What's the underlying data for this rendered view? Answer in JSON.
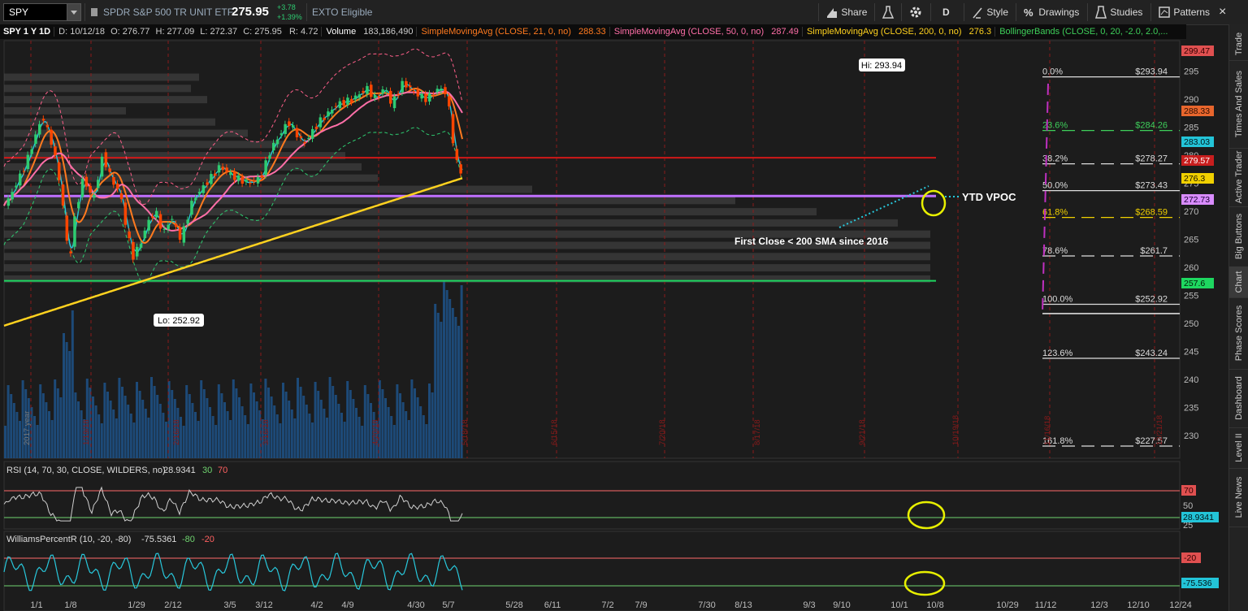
{
  "toolbar": {
    "symbol": "SPY",
    "description": "SPDR S&P 500 TR UNIT ETF",
    "last_price": "275.95",
    "change": "+3.78",
    "change_pct": "+1.39%",
    "exto": "EXTO Eligible",
    "share": "Share",
    "period_letter": "D",
    "style": "Style",
    "drawings": "Drawings",
    "studies": "Studies",
    "patterns": "Patterns"
  },
  "info": {
    "symbol_period": "SPY 1 Y 1D",
    "date": "D: 10/12/18",
    "open": "O: 276.77",
    "high": "H: 277.09",
    "low": "L: 272.37",
    "close": "C: 275.95",
    "range": "R: 4.72",
    "volume_label": "Volume",
    "volume_value": "183,186,490",
    "sma21_label": "SimpleMovingAvg (CLOSE, 21, 0, no)",
    "sma21_value": "288.33",
    "sma50_label": "SimpleMovingAvg (CLOSE, 50, 0, no)",
    "sma50_value": "287.49",
    "sma200_label": "SimpleMovingAvg (CLOSE, 200, 0, no)",
    "sma200_value": "276.3",
    "bb_label": "BollingerBands (CLOSE, 0, 20, -2.0, 2.0,..."
  },
  "side_nav": [
    "Trade",
    "Times And Sales",
    "Active Trader",
    "Big Buttons",
    "Chart",
    "Phase Scores",
    "Dashboard",
    "Level II",
    "Live News"
  ],
  "price_axis": {
    "ticks": [
      "295",
      "290",
      "285",
      "280",
      "275",
      "270",
      "265",
      "260",
      "255",
      "250",
      "245",
      "240",
      "235",
      "230"
    ],
    "badges": [
      {
        "text": "299.47",
        "bg": "#e05050",
        "fg": "#300000"
      },
      {
        "text": "288.33",
        "bg": "#e8662d",
        "fg": "#2a0c00"
      },
      {
        "text": "283.03",
        "bg": "#23c4d8",
        "fg": "#001418"
      },
      {
        "text": "279.57",
        "bg": "#c81e1e",
        "fg": "#ffffff"
      },
      {
        "text": "276.3",
        "bg": "#f0d000",
        "fg": "#1a1400"
      },
      {
        "text": "272.73",
        "bg": "#d98cff",
        "fg": "#1a0030"
      },
      {
        "text": "257.6",
        "bg": "#1ed760",
        "fg": "#001a08"
      }
    ]
  },
  "date_axis": [
    "1/1",
    "1/8",
    "1/29",
    "2/12",
    "3/5",
    "3/12",
    "4/2",
    "4/9",
    "4/30",
    "5/7",
    "5/28",
    "6/11",
    "7/2",
    "7/9",
    "7/30",
    "8/13",
    "9/3",
    "9/10",
    "10/1",
    "10/8",
    "10/29",
    "11/12",
    "12/3",
    "12/10",
    "12/24"
  ],
  "vertical_date_labels": [
    "2017 year",
    "1/19/18",
    "2/16/18",
    "3/16/18",
    "4/20/18",
    "5/18/18",
    "6/15/18",
    "7/20/18",
    "8/17/18",
    "9/21/18",
    "10/19/18",
    "11/16/18",
    "12/21/18"
  ],
  "fibonacci": [
    {
      "pct": "0.0%",
      "price": "$293.94",
      "color": "#dddddd"
    },
    {
      "pct": "23.6%",
      "price": "$284.26",
      "color": "#3ecf5a"
    },
    {
      "pct": "38.2%",
      "price": "$278.27",
      "color": "#dddddd"
    },
    {
      "pct": "50.0%",
      "price": "$273.43",
      "color": "#dddddd"
    },
    {
      "pct": "61.8%",
      "price": "$268.59",
      "color": "#f0d000"
    },
    {
      "pct": "78.6%",
      "price": "$261.7",
      "color": "#dddddd"
    },
    {
      "pct": "100.0%",
      "price": "$252.92",
      "color": "#dddddd"
    },
    {
      "pct": "123.6%",
      "price": "$243.24",
      "color": "#dddddd"
    },
    {
      "pct": "161.8%",
      "price": "$227.57",
      "color": "#dddddd"
    }
  ],
  "annotations": {
    "hi": "Hi: 293.94",
    "lo": "Lo: 252.92",
    "ytd_vpoc": "YTD  VPOC",
    "first_close": "First Close < 200 SMA since 2016"
  },
  "rsi": {
    "label": "RSI (14, 70, 30, CLOSE, WILDERS, no)",
    "value": "28.9341",
    "ob": "30",
    "os": "70",
    "axis_50": "50",
    "axis_25": "25",
    "badge_70": "70",
    "badge_val": "28.9341"
  },
  "williams": {
    "label": "WilliamsPercentR (10, -20, -80)",
    "value": "-75.5361",
    "lv80": "-80",
    "lv20": "-20",
    "badge_20": "-20",
    "badge_val": "-75.536"
  },
  "colors": {
    "up": "#2ecc71",
    "down": "#ff4500",
    "sma21": "#ff7a1f",
    "sma50": "#ff6fa8",
    "sma200": "#ffd21f",
    "ema": "#28c8dc",
    "bb": "#ff5f8a",
    "volume": "#1d4a78",
    "fib_line": "#ddd"
  }
}
